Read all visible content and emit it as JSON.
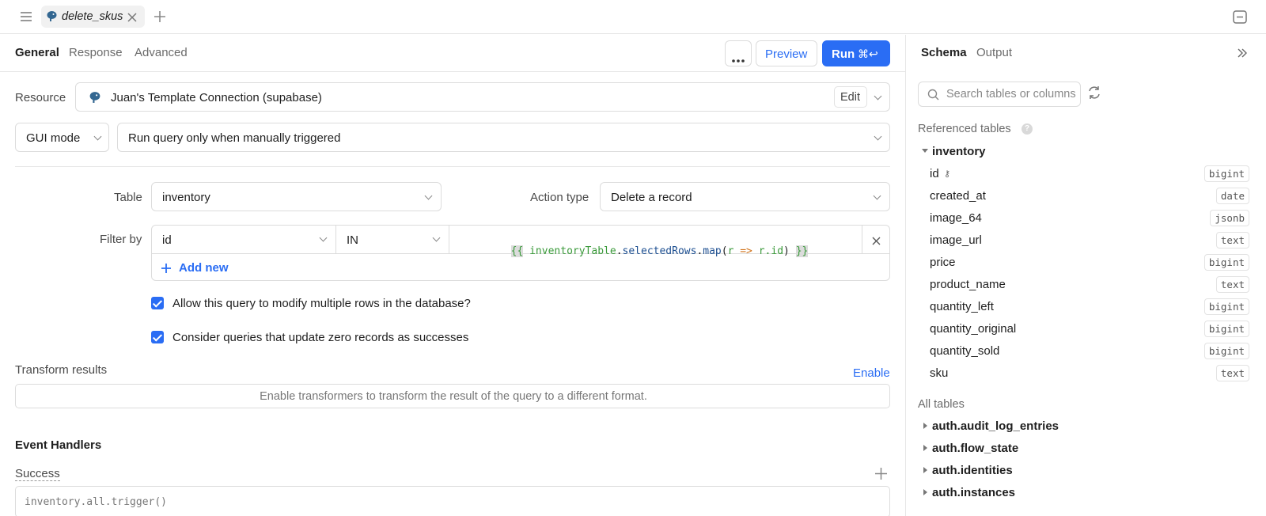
{
  "tabbar": {
    "query_tab_label": "delete_skus"
  },
  "header": {
    "tabs": [
      "General",
      "Response",
      "Advanced"
    ],
    "preview_label": "Preview",
    "run_label": "Run",
    "run_shortcut": "⌘↩"
  },
  "resource": {
    "label": "Resource",
    "value": "Juan's Template Connection (supabase)",
    "edit_label": "Edit"
  },
  "mode": {
    "gui_mode": "GUI mode",
    "trigger": "Run query only when manually triggered"
  },
  "action": {
    "table_label": "Table",
    "table_value": "inventory",
    "action_type_label": "Action type",
    "action_type_value": "Delete a record"
  },
  "filter": {
    "label": "Filter by",
    "column": "id",
    "operator": "IN",
    "code": {
      "open": "{{",
      "sp": " ",
      "obj": "inventoryTable",
      "dot1": ".",
      "prop": "selectedRows",
      "dot2": ".",
      "fn": "map",
      "p1": "(",
      "arg": "r",
      "arrow": "=>",
      "expr": "r.id",
      "p2": ")",
      "close": "}}"
    },
    "add_new_label": "Add new"
  },
  "options": {
    "allow_multiple": "Allow this query to modify multiple rows in the database?",
    "zero_records": "Consider queries that update zero records as successes",
    "allow_multiple_checked": true,
    "zero_records_checked": true
  },
  "transform": {
    "label": "Transform results",
    "enable_label": "Enable",
    "hint": "Enable transformers to transform the result of the query to a different format."
  },
  "events": {
    "heading": "Event Handlers",
    "success_label": "Success",
    "success_item": "inventory.all.trigger()"
  },
  "schema": {
    "tabs": [
      "Schema",
      "Output"
    ],
    "search_placeholder": "Search tables or columns",
    "referenced_label": "Referenced tables",
    "referenced_table": "inventory",
    "columns": [
      {
        "name": "id",
        "type": "bigint"
      },
      {
        "name": "created_at",
        "type": "date"
      },
      {
        "name": "image_64",
        "type": "jsonb"
      },
      {
        "name": "image_url",
        "type": "text"
      },
      {
        "name": "price",
        "type": "bigint"
      },
      {
        "name": "product_name",
        "type": "text"
      },
      {
        "name": "quantity_left",
        "type": "bigint"
      },
      {
        "name": "quantity_original",
        "type": "bigint"
      },
      {
        "name": "quantity_sold",
        "type": "bigint"
      },
      {
        "name": "sku",
        "type": "text"
      }
    ],
    "all_tables_label": "All tables",
    "all_tables": [
      "auth.audit_log_entries",
      "auth.flow_state",
      "auth.identities",
      "auth.instances"
    ]
  },
  "colors": {
    "accent": "#2a6df4",
    "code_green": "#3a9a3a",
    "code_blue": "#1d4f91",
    "code_orange": "#d1731a"
  }
}
